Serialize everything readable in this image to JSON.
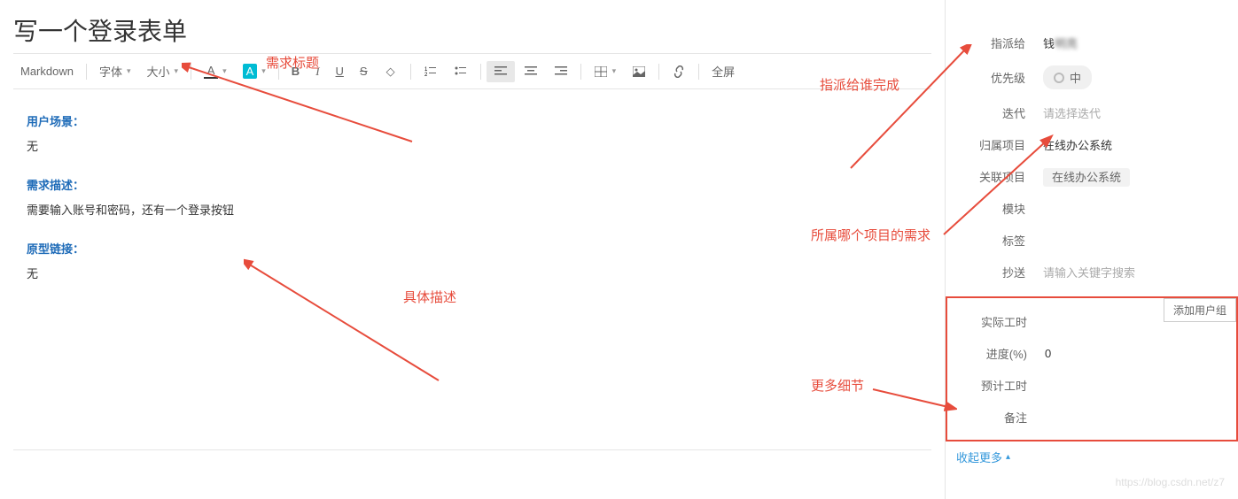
{
  "title": "写一个登录表单",
  "toolbar": {
    "mode": "Markdown",
    "font": "字体",
    "size": "大小",
    "fullscreen": "全屏"
  },
  "editor": {
    "scene_label": "用户场景：",
    "scene_content": "无",
    "desc_label": "需求描述：",
    "desc_content": "需要输入账号和密码，还有一个登录按钮",
    "proto_label": "原型链接：",
    "proto_content": "无"
  },
  "sidebar": {
    "assignee_label": "指派给",
    "assignee_value": "钱",
    "priority_label": "优先级",
    "priority_value": "中",
    "iteration_label": "迭代",
    "iteration_placeholder": "请选择迭代",
    "project_label": "归属项目",
    "project_value": "在线办公系统",
    "related_label": "关联项目",
    "related_value": "在线办公系统",
    "module_label": "模块",
    "tags_label": "标签",
    "cc_label": "抄送",
    "cc_placeholder": "请输入关键字搜索",
    "add_group": "添加用户组",
    "actual_hours_label": "实际工时",
    "progress_label": "进度(%)",
    "progress_value": "0",
    "estimate_label": "预计工时",
    "remark_label": "备注",
    "collapse": "收起更多"
  },
  "annotations": {
    "title_anno": "需求标题",
    "assign_anno": "指派给谁完成",
    "project_anno": "所属哪个项目的需求",
    "desc_anno": "具体描述",
    "more_anno": "更多细节"
  },
  "watermark": "https://blog.csdn.net/z7"
}
